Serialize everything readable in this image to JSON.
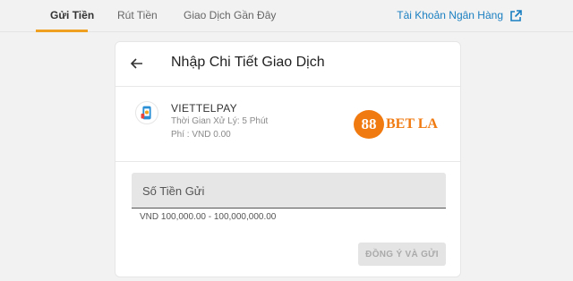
{
  "tabs": [
    {
      "label": "Gửi Tiền",
      "active": true
    },
    {
      "label": "Rút Tiền",
      "active": false
    },
    {
      "label": "Giao Dịch Gần Đây",
      "active": false
    }
  ],
  "bank_link": {
    "label": "Tài Khoản Ngân Hàng",
    "icon": "external-link-icon"
  },
  "card": {
    "title": "Nhập Chi Tiết Giao Dịch",
    "back_icon": "arrow-left-icon"
  },
  "method": {
    "name": "VIETTELPAY",
    "time": "Thời Gian Xử Lý: 5 Phút",
    "fee": "Phí : VND 0.00",
    "icon": "viettelpay-icon"
  },
  "logo": {
    "number": "88",
    "text": "BET LA"
  },
  "amount": {
    "placeholder": "Số Tiền Gửi",
    "hint": "VND 100,000.00 - 100,000,000.00"
  },
  "submit": {
    "label": "ĐỒNG Ý VÀ GỬI"
  },
  "colors": {
    "accent": "#f0a020",
    "link": "#1a7fc1",
    "logo": "#f07a10"
  }
}
